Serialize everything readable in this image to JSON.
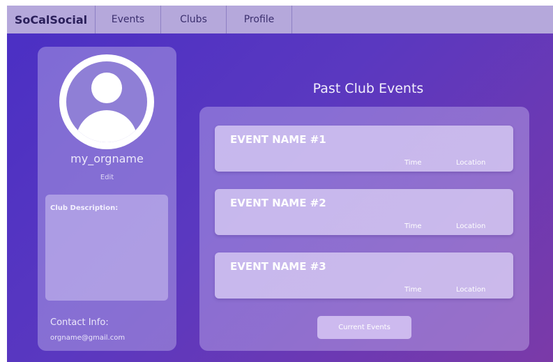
{
  "nav": {
    "brand": "SoCalSocial",
    "links": [
      "Events",
      "Clubs",
      "Profile"
    ]
  },
  "profile": {
    "org_name": "my_orgname",
    "edit_label": "Edit",
    "description_label": "Club Description:",
    "contact_label": "Contact Info:",
    "contact_email": "orgname@gmail.com"
  },
  "events_section": {
    "title": "Past Club Events",
    "events": [
      {
        "name": "EVENT NAME #1",
        "time": "Time",
        "location": "Location"
      },
      {
        "name": "EVENT NAME #2",
        "time": "Time",
        "location": "Location"
      },
      {
        "name": "EVENT NAME #3",
        "time": "Time",
        "location": "Location"
      }
    ],
    "current_button": "Current Events"
  },
  "colors": {
    "navbar": "#b5a8db",
    "gradient_start": "#4a2fc4",
    "gradient_end": "#7b3aa8",
    "avatar_bg": "#8f7fd6"
  },
  "icons": {
    "avatar": "user-avatar-icon"
  }
}
